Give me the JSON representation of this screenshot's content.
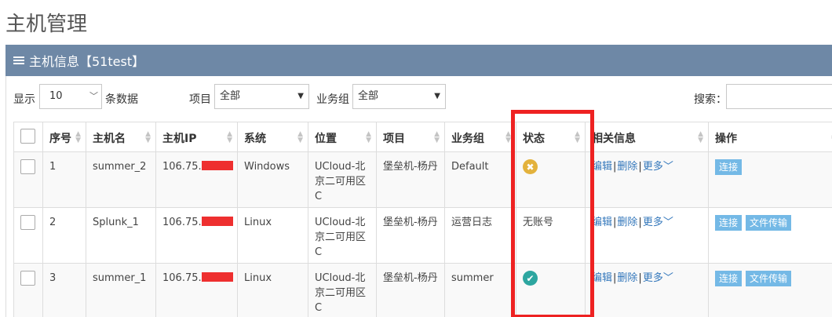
{
  "page": {
    "title": "主机管理"
  },
  "panel": {
    "title": "主机信息【51test】"
  },
  "controls": {
    "show_label": "显示",
    "page_size": "10",
    "per_page_suffix": "条数据",
    "project_label": "项目",
    "project_value": "全部",
    "group_label": "业务组",
    "group_value": "全部",
    "search_label": "搜索："
  },
  "table": {
    "headers": [
      "序号",
      "主机名",
      "主机IP",
      "系统",
      "位置",
      "项目",
      "业务组",
      "状态",
      "相关信息",
      "操作"
    ],
    "rows": [
      {
        "index": "1",
        "hostname": "summer_2",
        "ip": "106.75.",
        "os": "Windows",
        "location": "UCloud-北京二可用区C",
        "project": "堡垒机-杨丹",
        "group": "Default",
        "status_type": "error",
        "status_text": "",
        "buttons": [
          "连接"
        ]
      },
      {
        "index": "2",
        "hostname": "Splunk_1",
        "ip": "106.75.",
        "os": "Linux",
        "location": "UCloud-北京二可用区C",
        "project": "堡垒机-杨丹",
        "group": "运营日志",
        "status_type": "text",
        "status_text": "无账号",
        "buttons": [
          "连接",
          "文件传输"
        ]
      },
      {
        "index": "3",
        "hostname": "summer_1",
        "ip": "106.75.",
        "os": "Linux",
        "location": "UCloud-北京二可用区C",
        "project": "堡垒机-杨丹",
        "group": "summer",
        "status_type": "ok",
        "status_text": "",
        "buttons": [
          "连接",
          "文件传输"
        ]
      }
    ],
    "links": {
      "edit": "编辑",
      "delete": "删除",
      "more": "更多"
    }
  },
  "colors": {
    "header_bg": "#6e88a6",
    "link": "#3377bb",
    "button": "#74b9e6",
    "highlight": "#ee2222",
    "status_error": "#e3b23c",
    "status_ok": "#2da6a0"
  }
}
